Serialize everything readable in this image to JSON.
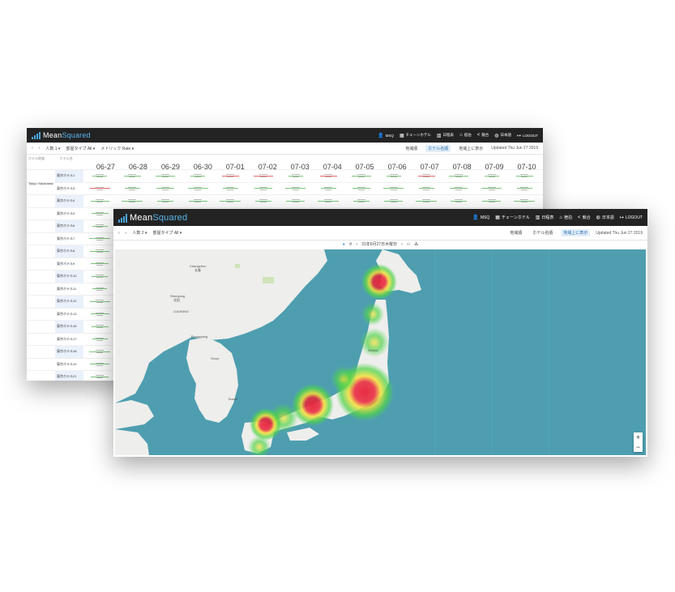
{
  "back": {
    "brand": {
      "part1": "Mean",
      "part2": "Squared"
    },
    "nav": [
      {
        "icon": "person-icon",
        "glyph": "👤",
        "label": "MSQ"
      },
      {
        "icon": "chart-icon",
        "glyph": "▦",
        "label": "チェーンホテル"
      },
      {
        "icon": "calendar-icon",
        "glyph": "▥",
        "label": "日程表"
      },
      {
        "icon": "bank-icon",
        "glyph": "⌂",
        "label": "宿泊"
      },
      {
        "icon": "share-icon",
        "glyph": "<",
        "label": "競合"
      },
      {
        "icon": "globe-icon",
        "glyph": "◍",
        "label": "日本語"
      },
      {
        "icon": "logout-icon",
        "glyph": "↦",
        "label": "LOGOUT"
      }
    ],
    "toolbar": {
      "prev": "‹",
      "next": "›",
      "guests": "人数",
      "guests_value": "1",
      "room_type": "部屋タイプ",
      "room_type_value": "All",
      "metric": "メトリック",
      "metric_value": "Rate",
      "views": [
        "地域順",
        "ホテル名順",
        "地域上に表示"
      ],
      "updated": "Updated Thu Jun 27 2019"
    },
    "headers": {
      "region": "ホテル地域",
      "hotel": "ホテル名"
    },
    "dates": [
      "06-27",
      "06-28",
      "06-29",
      "06-30",
      "07-01",
      "07-02",
      "07-03",
      "07-04",
      "07-05",
      "07-06",
      "07-07",
      "07-08",
      "07-09",
      "07-10"
    ],
    "region": "Tokyo Yokohama",
    "hotels": [
      "東京ホテル1",
      "東京ホテル3",
      "東京ホテル4",
      "東京ホテル5",
      "東京ホテル6",
      "東京ホテル7",
      "東京ホテル8",
      "東京ホテル9",
      "東京ホテル10",
      "東京ホテル11",
      "東京ホテル12",
      "東京ホテル13",
      "東京ホテル16",
      "東京ホテル17",
      "東京ホテル18",
      "東京ホテル19",
      "東京ホテル21",
      "東京ホテル24"
    ],
    "red_cells": [
      [
        0,
        4
      ],
      [
        0,
        5
      ],
      [
        0,
        7
      ],
      [
        0,
        10
      ],
      [
        1,
        0
      ]
    ]
  },
  "front": {
    "brand": {
      "part1": "Mean",
      "part2": "Squared"
    },
    "nav": [
      {
        "icon": "person-icon",
        "glyph": "👤",
        "label": "MSQ"
      },
      {
        "icon": "chart-icon",
        "glyph": "▦",
        "label": "チェーンホテル"
      },
      {
        "icon": "calendar-icon",
        "glyph": "▥",
        "label": "日程表"
      },
      {
        "icon": "bank-icon",
        "glyph": "⌂",
        "label": "宿泊"
      },
      {
        "icon": "share-icon",
        "glyph": "<",
        "label": "競合"
      },
      {
        "icon": "globe-icon",
        "glyph": "◍",
        "label": "日本語"
      },
      {
        "icon": "logout-icon",
        "glyph": "↦",
        "label": "LOGOUT"
      }
    ],
    "toolbar": {
      "prev": "‹",
      "next": "›",
      "guests": "人数",
      "guests_value": "2",
      "room_type": "部屋タイプ",
      "room_type_value": "All",
      "views": [
        "地域順",
        "ホテル名順",
        "地域上に表示"
      ],
      "updated": "Updated Thu Jun 27 2019"
    },
    "date_text": "31年6月27日木曜日",
    "map_labels": {
      "changchun": "Changchun",
      "city_cn": "长春",
      "shenyang": "Shenyang",
      "city_sy": "沈阳",
      "liaoning": "LIAONING",
      "pyongyang": "Pyongyang",
      "seoul": "Seoul",
      "busan": "Busan",
      "sendai": "Sendai",
      "zoom_in": "+",
      "zoom_out": "−"
    },
    "hotspots_color": {
      "core": "#e8233a",
      "mid": "#f6e23a",
      "outer": "#4fd34a"
    }
  }
}
